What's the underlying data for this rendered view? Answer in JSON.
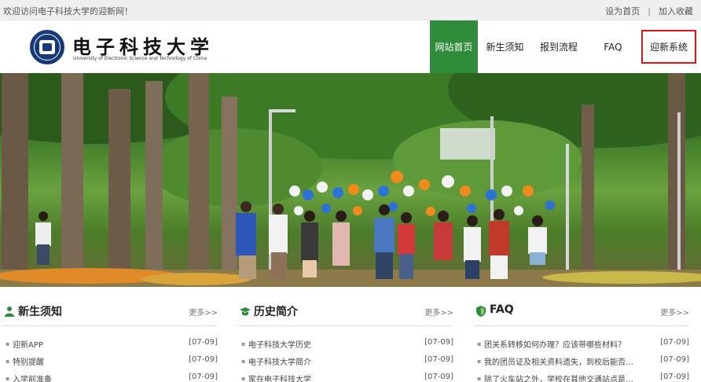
{
  "topbar": {
    "welcome": "欢迎访问电子科技大学的迎新网！",
    "set_home": "设为首页",
    "separator": "|",
    "bookmark": "加入收藏"
  },
  "header": {
    "logo_cn": "电子科技大学",
    "logo_en": "University of Electronic Science and Technology of China",
    "seal_text": "UESTC"
  },
  "nav": {
    "items": [
      {
        "label": "网站首页",
        "active": true
      },
      {
        "label": "新生须知"
      },
      {
        "label": "报到流程"
      },
      {
        "label": "FAQ"
      },
      {
        "label": "迎新系统",
        "highlighted": true
      }
    ]
  },
  "colors": {
    "accent_green": "#2f8c3a",
    "highlight_red": "#e0151b",
    "seal_blue": "#16397a"
  },
  "sections": [
    {
      "title": "新生须知",
      "icon": "person-icon",
      "more": "更多>>",
      "items": [
        {
          "text": "迎新APP",
          "date": "[07-09]"
        },
        {
          "text": "特别提醒",
          "date": "[07-09]"
        },
        {
          "text": "入学前准备",
          "date": "[07-09]"
        }
      ]
    },
    {
      "title": "历史简介",
      "icon": "graduation-cap-icon",
      "more": "更多>>",
      "items": [
        {
          "text": "电子科技大学历史",
          "date": "[07-09]"
        },
        {
          "text": "电子科技大学简介",
          "date": "[07-09]"
        },
        {
          "text": "家在电子科技大学",
          "date": "[07-09]"
        }
      ]
    },
    {
      "title": "FAQ",
      "icon": "shield-icon",
      "more": "更多>>",
      "items": [
        {
          "text": "团关系转移如何办理？应该带哪些材料？",
          "date": "[07-09]"
        },
        {
          "text": "我的团员证及相关资料遗失，到校后能否补...",
          "date": "[07-09]"
        },
        {
          "text": "除了火车站之外，学校在其他交通站点是否...",
          "date": "[07-09]"
        }
      ]
    }
  ]
}
